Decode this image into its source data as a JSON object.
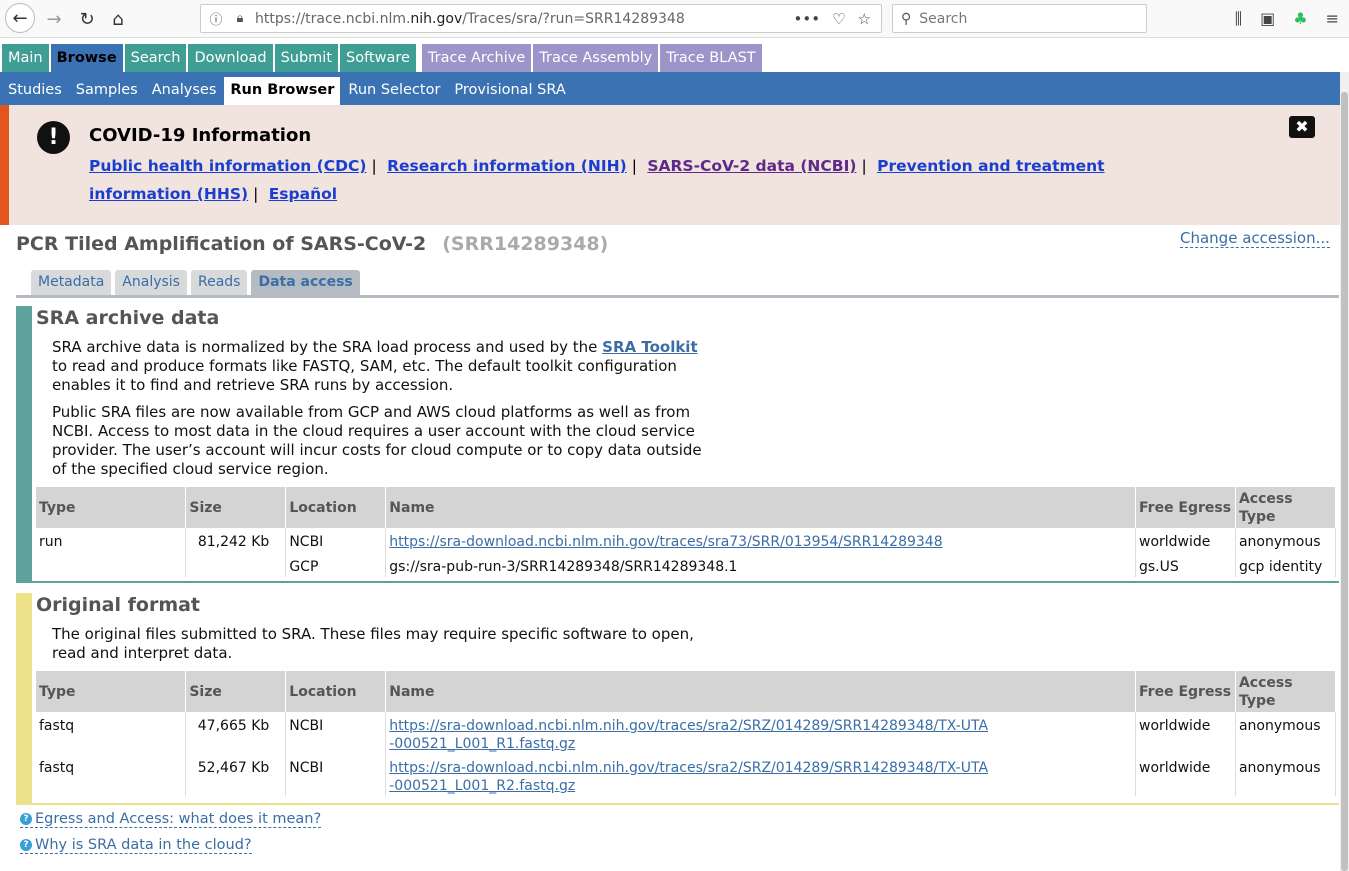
{
  "browser": {
    "url_prefix": "https://trace.ncbi.nlm.",
    "url_domain": "nih.gov",
    "url_path": "/Traces/sra/?run=SRR14289348",
    "search_placeholder": "Search"
  },
  "topnav": {
    "tabs": [
      "Main",
      "Browse",
      "Search",
      "Download",
      "Submit",
      "Software",
      "Trace Archive",
      "Trace Assembly",
      "Trace BLAST"
    ],
    "active": "Browse"
  },
  "subnav": {
    "tabs": [
      "Studies",
      "Samples",
      "Analyses",
      "Run Browser",
      "Run Selector",
      "Provisional SRA"
    ],
    "active": "Run Browser"
  },
  "covid": {
    "title": "COVID-19 Information",
    "links": [
      "Public health information (CDC)",
      "Research information (NIH)",
      "SARS-CoV-2 data (NCBI)",
      "Prevention and treatment information (HHS)",
      "Español"
    ],
    "separator": "|",
    "close_glyph": "✖"
  },
  "run": {
    "title": "PCR Tiled Amplification of SARS-CoV-2",
    "accession": "(SRR14289348)",
    "change_accession": "Change accession..."
  },
  "tabs": [
    "Metadata",
    "Analysis",
    "Reads",
    "Data access"
  ],
  "sra_archive": {
    "title": "SRA archive data",
    "para1_pre": "SRA archive data is normalized by the SRA load process and used by the ",
    "para1_link": "SRA Toolkit",
    "para1_post": " to read and produce formats like FASTQ, SAM, etc. The default toolkit configuration enables it to find and retrieve SRA runs by accession.",
    "para2": "Public SRA files are now available from GCP and AWS cloud platforms as well as from NCBI. Access to most data in the cloud requires a user account with the cloud service provider. The user’s account will incur costs for cloud compute or to copy data outside of the specified cloud service region.",
    "headers": [
      "Type",
      "Size",
      "Location",
      "Name",
      "Free Egress",
      "Access Type"
    ],
    "rows": [
      {
        "type": "run",
        "size": "81,242 Kb",
        "location": "NCBI",
        "name": "https://sra-download.ncbi.nlm.nih.gov/traces/sra73/SRR/013954/SRR14289348",
        "name_is_link": true,
        "egress": "worldwide",
        "access": "anonymous"
      },
      {
        "type": "",
        "size": "",
        "location": "GCP",
        "name": "gs://sra-pub-run-3/SRR14289348/SRR14289348.1",
        "name_is_link": false,
        "egress": "gs.US",
        "access": "gcp identity"
      }
    ]
  },
  "original_format": {
    "title": "Original format",
    "para": "The original files submitted to SRA. These files may require specific software to open, read and interpret data.",
    "headers": [
      "Type",
      "Size",
      "Location",
      "Name",
      "Free Egress",
      "Access Type"
    ],
    "rows": [
      {
        "type": "fastq",
        "size": "47,665 Kb",
        "location": "NCBI",
        "name": "https://sra-download.ncbi.nlm.nih.gov/traces/sra2/SRZ/014289/SRR14289348/TX-UTA-000521_L001_R1.fastq.gz",
        "egress": "worldwide",
        "access": "anonymous"
      },
      {
        "type": "fastq",
        "size": "52,467 Kb",
        "location": "NCBI",
        "name": "https://sra-download.ncbi.nlm.nih.gov/traces/sra2/SRZ/014289/SRR14289348/TX-UTA-000521_L001_R2.fastq.gz",
        "egress": "worldwide",
        "access": "anonymous"
      }
    ]
  },
  "help": {
    "egress": "Egress and Access: what does it mean?",
    "cloud": "Why is SRA data in the cloud?"
  }
}
